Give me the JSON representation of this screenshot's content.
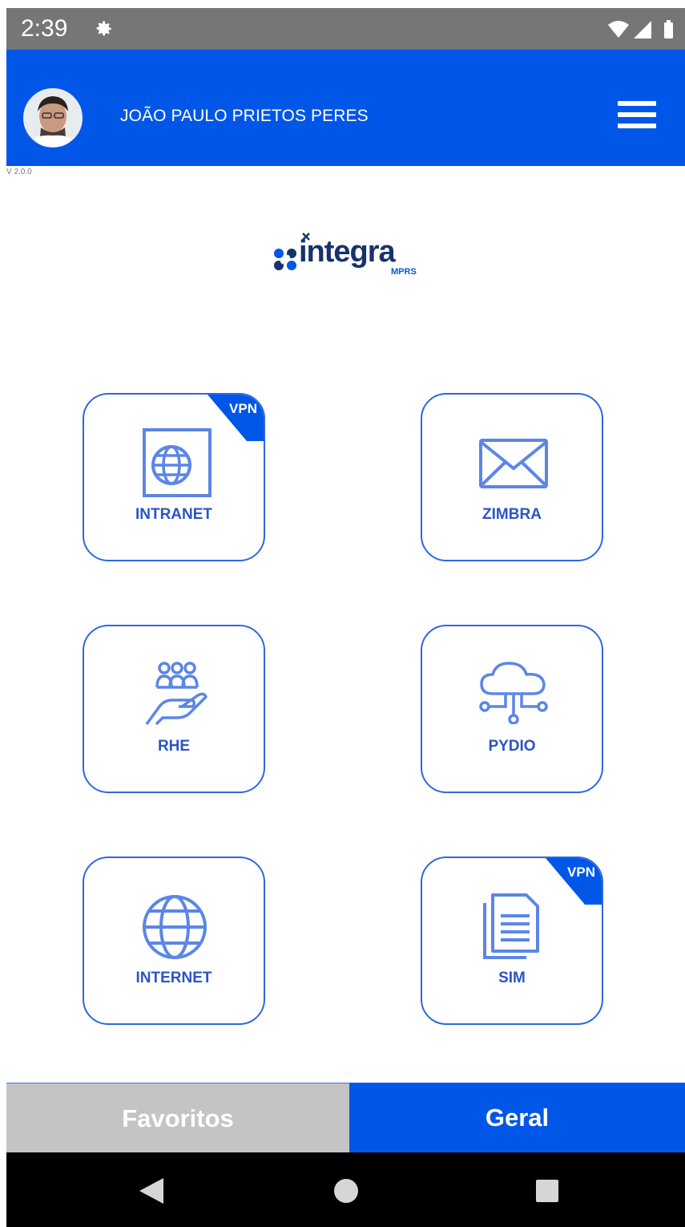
{
  "status_bar": {
    "time": "2:39",
    "icons": [
      "gear-icon",
      "wifi-icon",
      "signal-icon",
      "battery-icon"
    ]
  },
  "header": {
    "user_name": "JOÃO PAULO PRIETOS PERES",
    "menu_icon": "hamburger-menu-icon",
    "background_color": "#0057e7"
  },
  "version": "V 2.0.0",
  "logo": {
    "word": "integra",
    "sub": "MPRS"
  },
  "tiles": [
    {
      "label": "INTRANET",
      "badge": "VPN",
      "icon": "intranet-globe-icon"
    },
    {
      "label": "ZIMBRA",
      "badge": "",
      "icon": "mail-envelope-icon"
    },
    {
      "label": "RHE",
      "badge": "",
      "icon": "people-hand-icon"
    },
    {
      "label": "PYDIO",
      "badge": "",
      "icon": "cloud-network-icon"
    },
    {
      "label": "INTERNET",
      "badge": "",
      "icon": "globe-icon"
    },
    {
      "label": "SIM",
      "badge": "VPN",
      "icon": "documents-icon"
    }
  ],
  "tabs": {
    "favoritos": "Favoritos",
    "geral": "Geral",
    "active": "Geral"
  },
  "colors": {
    "accent": "#0057e7",
    "tile_border": "#2f67e0",
    "tile_text": "#2b54c8",
    "inactive_tab": "#c4c4c4"
  },
  "nav_bar": {
    "icons": [
      "back-icon",
      "home-icon",
      "recents-icon"
    ]
  }
}
